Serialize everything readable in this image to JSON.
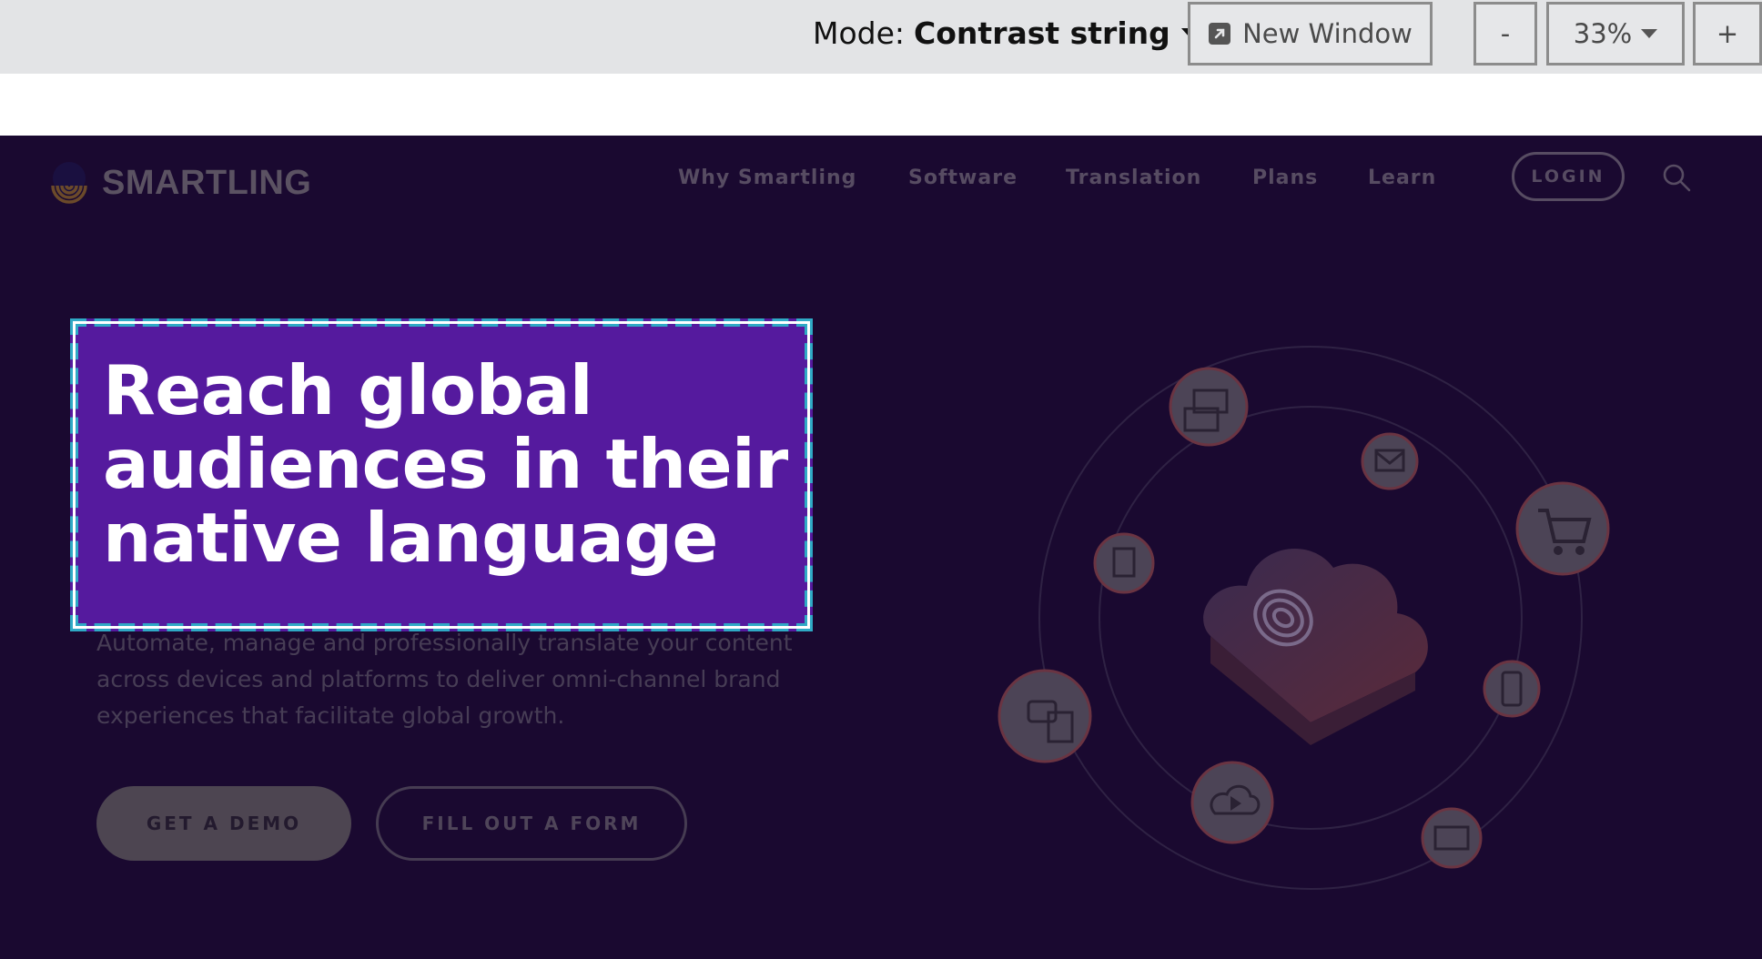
{
  "toolbar": {
    "mode_label": "Mode:",
    "mode_value": "Contrast string",
    "new_window_label": "New Window",
    "zoom_out_label": "-",
    "zoom_value": "33%",
    "zoom_in_label": "+",
    "icons": [
      "caret-down-icon",
      "new-window-icon"
    ]
  },
  "site": {
    "logo_text": "SMARTLING",
    "nav": [
      "Why Smartling",
      "Software",
      "Translation",
      "Plans",
      "Learn"
    ],
    "login_label": "LOGIN",
    "hero": {
      "title": "Reach global audiences in their native language",
      "subtitle": "Automate, manage and professionally translate your content across devices and platforms to deliver omni-channel brand experiences that facilitate global growth.",
      "cta_primary": "GET A DEMO",
      "cta_secondary": "FILL OUT A FORM"
    },
    "colors": {
      "background": "#1a0930",
      "highlight_fill": "#551a9e",
      "highlight_border": "#2fa9c5"
    },
    "illustration_icons": [
      "translate-screens-icon",
      "email-icon",
      "shopping-cart-icon",
      "document-icon",
      "cloud-fingerprint-icon",
      "mobile-app-icon",
      "chat-documents-icon",
      "video-cloud-icon",
      "subtitles-screen-icon"
    ]
  }
}
